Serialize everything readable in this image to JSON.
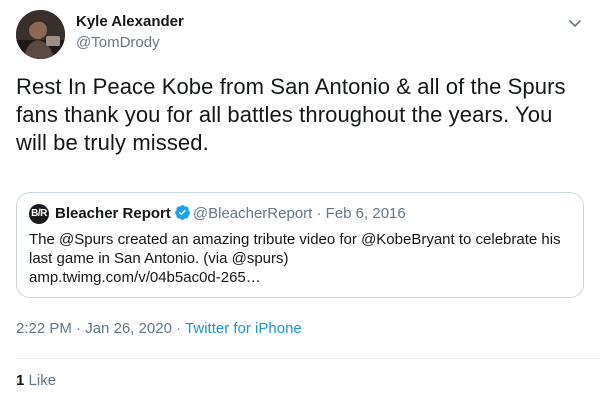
{
  "author": {
    "name": "Kyle Alexander",
    "handle": "@TomDrody",
    "avatar_icon": "profile-photo"
  },
  "tweet": {
    "text": "Rest In Peace Kobe from San Antonio & all of the Spurs fans thank you for all battles throughout the years. You will be truly missed."
  },
  "quoted": {
    "avatar_text": "B/R",
    "name": "Bleacher Report",
    "verified": true,
    "handle": "@BleacherReport",
    "separator": "·",
    "date": "Feb 6, 2016",
    "body_line1": "The @Spurs created an amazing tribute video for @KobeBryant to celebrate his",
    "body_line2": "last game in San Antonio. (via @spurs)",
    "body_line3": "amp.twimg.com/v/04b5ac0d-265…"
  },
  "meta": {
    "time": "2:22 PM",
    "separator1": "·",
    "date": "Jan 26, 2020",
    "separator2": "·",
    "source": "Twitter for iPhone"
  },
  "stats": {
    "likes_count": "1",
    "likes_label": "Like"
  },
  "colors": {
    "link": "#1b95e0",
    "secondary": "#657786",
    "border": "#ccd6dd",
    "verified": "#1da1f2"
  }
}
